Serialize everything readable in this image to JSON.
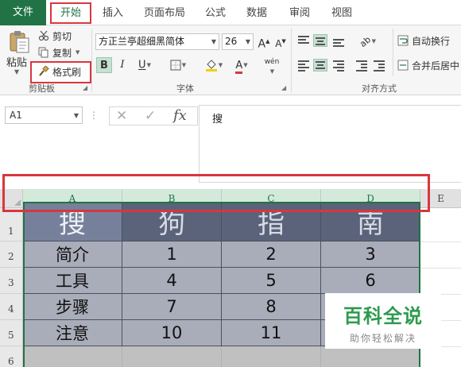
{
  "tabs": [
    "文件",
    "开始",
    "插入",
    "页面布局",
    "公式",
    "数据",
    "审阅",
    "视图"
  ],
  "clipboard": {
    "paste": "粘贴",
    "cut": "剪切",
    "copy": "复制",
    "format_painter": "格式刷",
    "group_label": "剪贴板"
  },
  "font": {
    "name": "方正兰亭超细黑简体",
    "size": "26",
    "grow": "A",
    "shrink": "A",
    "bold": "B",
    "italic": "I",
    "underline": "U",
    "font_color": "A",
    "phonetic": "wén",
    "group_label": "字体"
  },
  "alignment": {
    "wrap_text": "自动换行",
    "merge_center": "合并后居中",
    "group_label": "对齐方式"
  },
  "formula_bar": {
    "name_box": "A1",
    "fx_label": "fx",
    "content": "搜"
  },
  "sheet": {
    "columns": [
      "A",
      "B",
      "C",
      "D",
      "E"
    ],
    "rows": [
      "1",
      "2",
      "3",
      "4",
      "5",
      "6"
    ],
    "header_row": [
      "搜",
      "狗",
      "指",
      "南"
    ],
    "data_rows": [
      [
        "简介",
        "1",
        "2",
        "3"
      ],
      [
        "工具",
        "4",
        "5",
        "6"
      ],
      [
        "步骤",
        "7",
        "8",
        ""
      ],
      [
        "注意",
        "10",
        "11",
        ""
      ]
    ]
  },
  "watermark": {
    "title": "百科全说",
    "subtitle": "助你轻松解决"
  },
  "colors": {
    "excel_green": "#217346",
    "highlight_red": "#d9363e",
    "header_fill": "#5a6379",
    "data_fill": "#a9adb9"
  }
}
